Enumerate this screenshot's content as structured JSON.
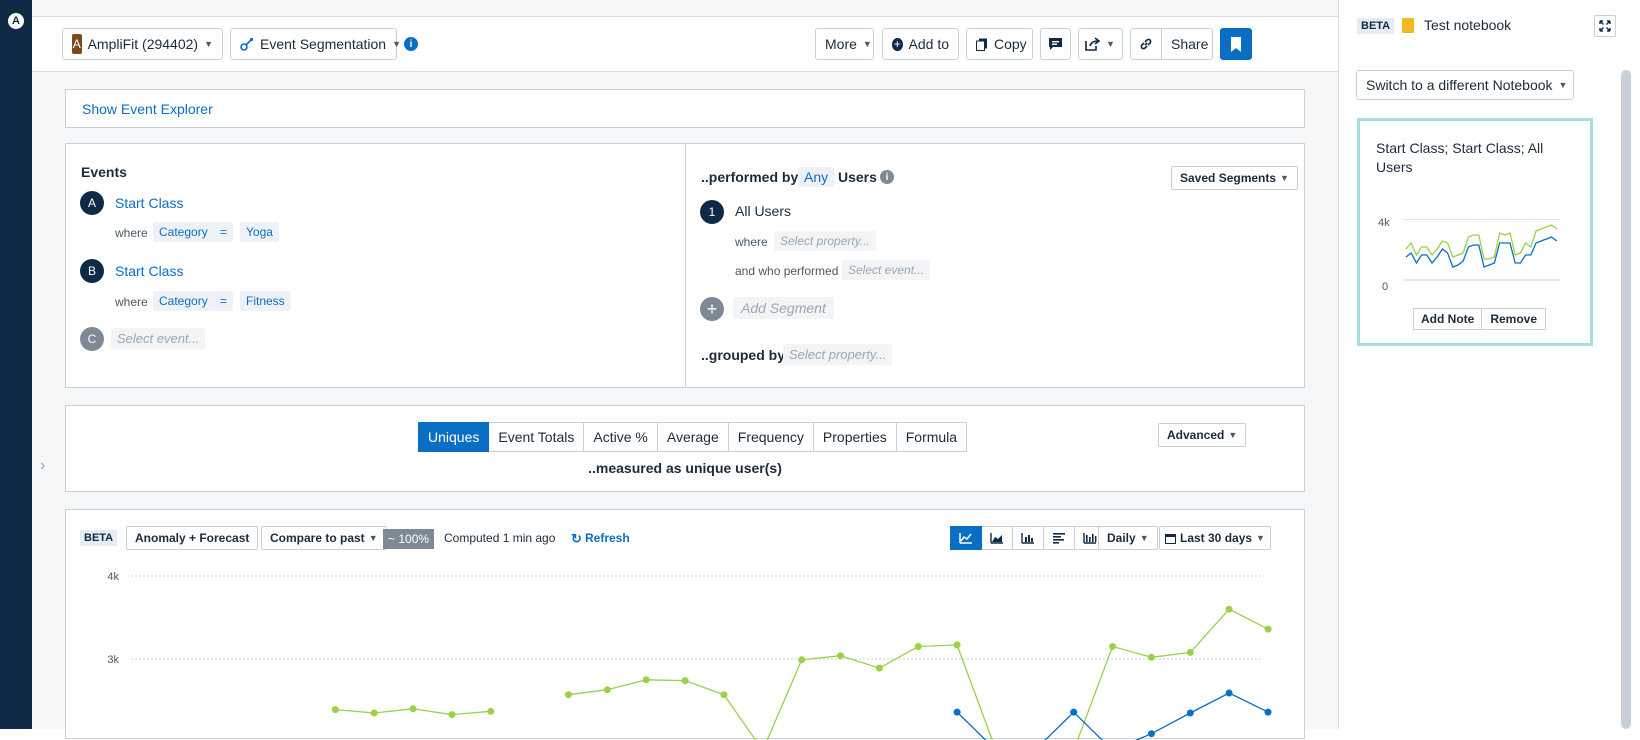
{
  "app": {
    "logo_glyph": "A"
  },
  "toolbar": {
    "project_badge": "A",
    "project_label": "AmpliFit (294402)",
    "chart_type_label": "Event Segmentation",
    "more_label": "More",
    "add_to_label": "Add to",
    "copy_label": "Copy",
    "share_label": "Share"
  },
  "explorer": {
    "label": "Show Event Explorer"
  },
  "events": {
    "heading": "Events",
    "items": [
      {
        "letter": "A",
        "name": "Start Class",
        "where": "where",
        "property": "Category",
        "operator": "=",
        "value": "Yoga"
      },
      {
        "letter": "B",
        "name": "Start Class",
        "where": "where",
        "property": "Category",
        "operator": "=",
        "value": "Fitness"
      }
    ],
    "new_letter": "C",
    "new_placeholder": "Select event..."
  },
  "segments": {
    "performed_by": "..performed by",
    "any": "Any",
    "users": "Users",
    "saved_segments": "Saved Segments",
    "segment_number": "1",
    "segment_name": "All Users",
    "where": "where",
    "where_placeholder": "Select property...",
    "who_performed": "and who performed",
    "who_placeholder": "Select event...",
    "add_segment": "Add Segment",
    "grouped_by": "..grouped by",
    "grouped_placeholder": "Select property..."
  },
  "measure": {
    "tabs": [
      "Uniques",
      "Event Totals",
      "Active %",
      "Average",
      "Frequency",
      "Properties",
      "Formula"
    ],
    "active_tab": "Uniques",
    "caption": "..measured as unique user(s)",
    "advanced": "Advanced"
  },
  "chart_controls": {
    "beta": "BETA",
    "anomaly": "Anomaly + Forecast",
    "compare": "Compare to past",
    "percent": "~ 100%",
    "computed": "Computed 1 min ago",
    "refresh": "Refresh",
    "interval": "Daily",
    "range": "Last 30 days"
  },
  "colors": {
    "accent": "#0b6ec5",
    "series_a": "#0b6ec5",
    "series_b": "#9ad14b",
    "navy": "#0e2a47",
    "notebook_border": "#a8dde0"
  },
  "chart_data": {
    "type": "line",
    "ytick_labels": [
      "4k",
      "3k"
    ],
    "ylim": [
      2000,
      4200
    ],
    "x": [
      1,
      2,
      3,
      4,
      5,
      6,
      7,
      8,
      9,
      10,
      11,
      12,
      13,
      14,
      15,
      16,
      17,
      18,
      19,
      20,
      21,
      22,
      23,
      24,
      25,
      26,
      27,
      28,
      29,
      30
    ],
    "series": [
      {
        "color": "#9ad14b",
        "values": [
          null,
          null,
          null,
          null,
          null,
          2390,
          2350,
          2400,
          2330,
          2370,
          null,
          2570,
          2630,
          2750,
          2740,
          2570,
          1900,
          2990,
          3040,
          2890,
          3150,
          3170,
          1900,
          1900,
          1900,
          3150,
          3020,
          3080,
          3600,
          3360
        ]
      },
      {
        "color": "#0b6ec5",
        "values": [
          null,
          null,
          null,
          null,
          null,
          null,
          null,
          null,
          null,
          null,
          null,
          null,
          null,
          null,
          null,
          null,
          null,
          null,
          null,
          null,
          null,
          2360,
          1900,
          1900,
          2360,
          1900,
          2100,
          2350,
          2590,
          2360
        ]
      }
    ]
  },
  "notebook": {
    "beta": "BETA",
    "title": "Test notebook",
    "switch_label": "Switch to a different Notebook",
    "card_title": "Start Class; Start Class; All Users",
    "yticks": [
      "4k",
      "0"
    ],
    "add_note": "Add Note",
    "remove": "Remove"
  }
}
